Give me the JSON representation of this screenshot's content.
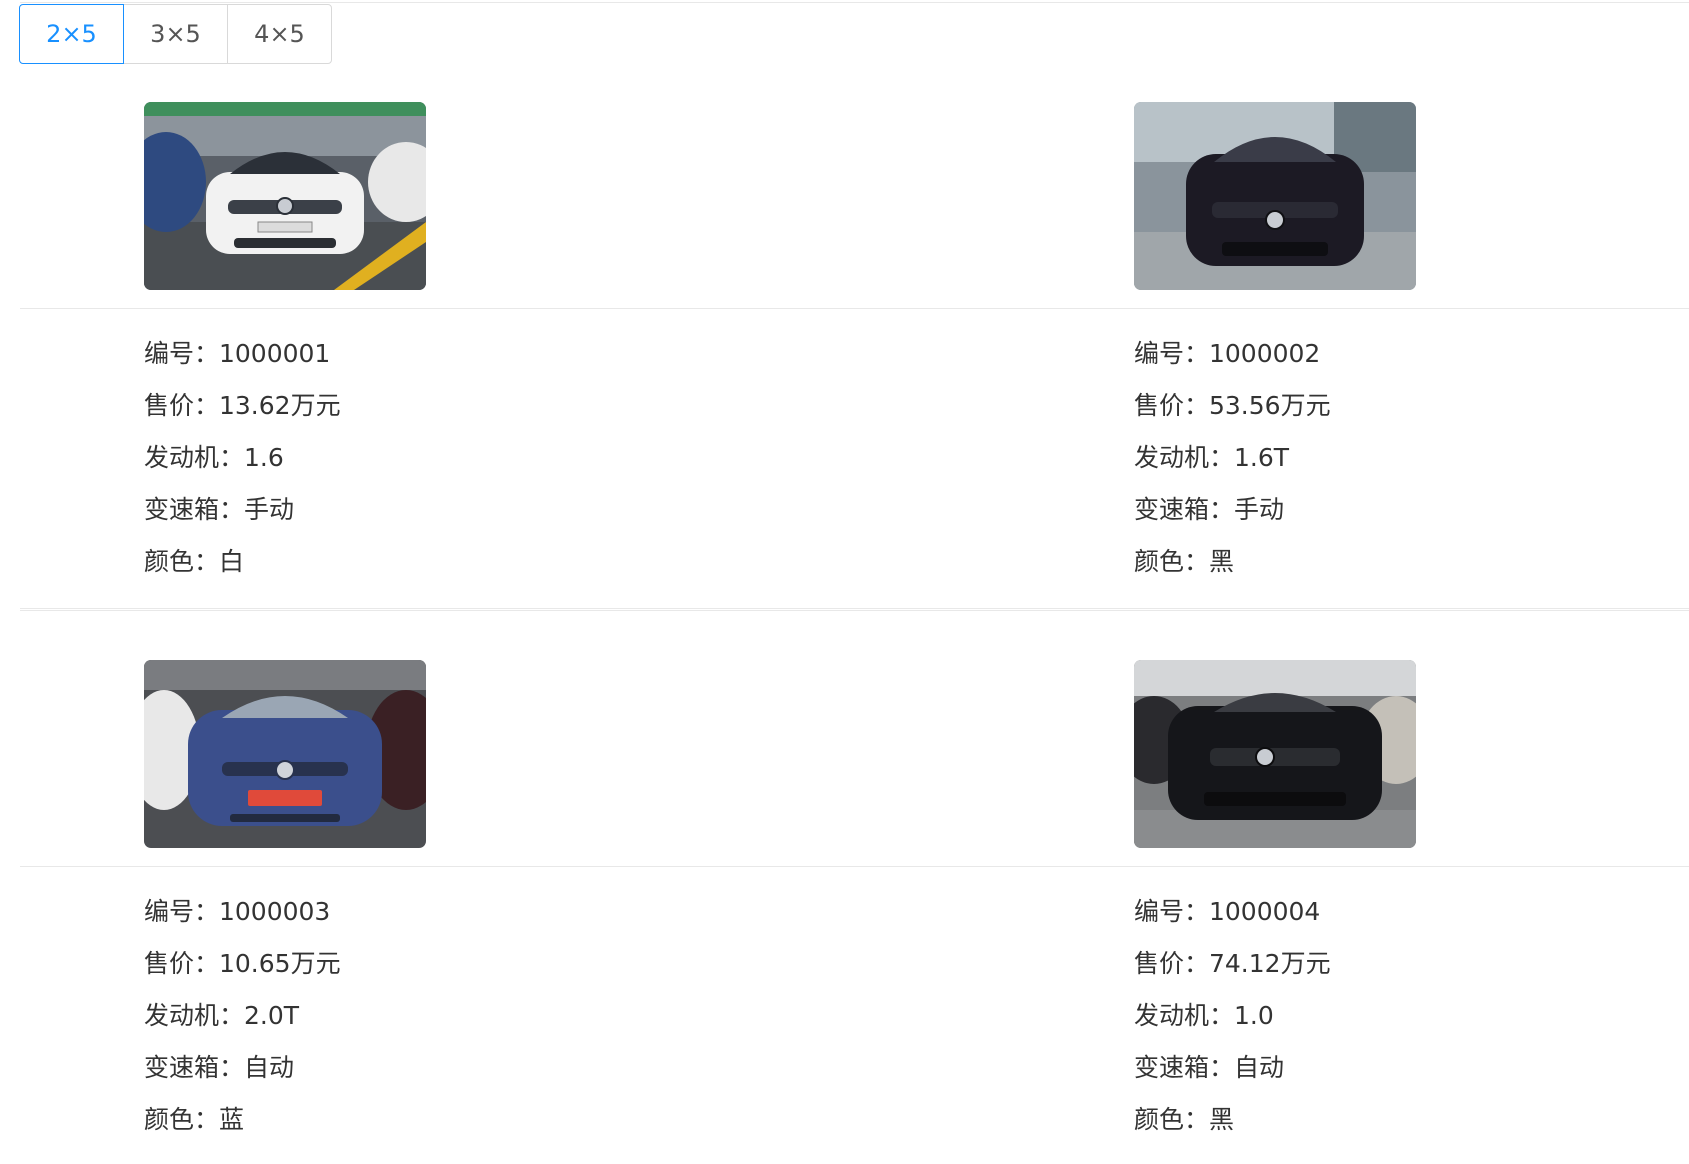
{
  "grid_options": [
    "2×5",
    "3×5",
    "4×5"
  ],
  "active_grid_index": 0,
  "cars": [
    {
      "id_label": "编号：1000001",
      "price_label": "售价：13.62万元",
      "engine_label": "发动机：1.6",
      "gearbox_label": "变速箱：手动",
      "color_label": "颜色：白",
      "car_color": "#f2f2f2"
    },
    {
      "id_label": "编号：1000002",
      "price_label": "售价：53.56万元",
      "engine_label": "发动机：1.6T",
      "gearbox_label": "变速箱：手动",
      "color_label": "颜色：黑",
      "car_color": "#1c1a24"
    },
    {
      "id_label": "编号：1000003",
      "price_label": "售价：10.65万元",
      "engine_label": "发动机：2.0T",
      "gearbox_label": "变速箱：自动",
      "color_label": "颜色：蓝",
      "car_color": "#3b4f8c"
    },
    {
      "id_label": "编号：1000004",
      "price_label": "售价：74.12万元",
      "engine_label": "发动机：1.0",
      "gearbox_label": "变速箱：自动",
      "color_label": "颜色：黑",
      "car_color": "#15161a"
    }
  ],
  "colors": {
    "accent": "#1890ff",
    "border": "#d9d9d9",
    "divider": "#e8e8e8",
    "text": "#333333"
  }
}
